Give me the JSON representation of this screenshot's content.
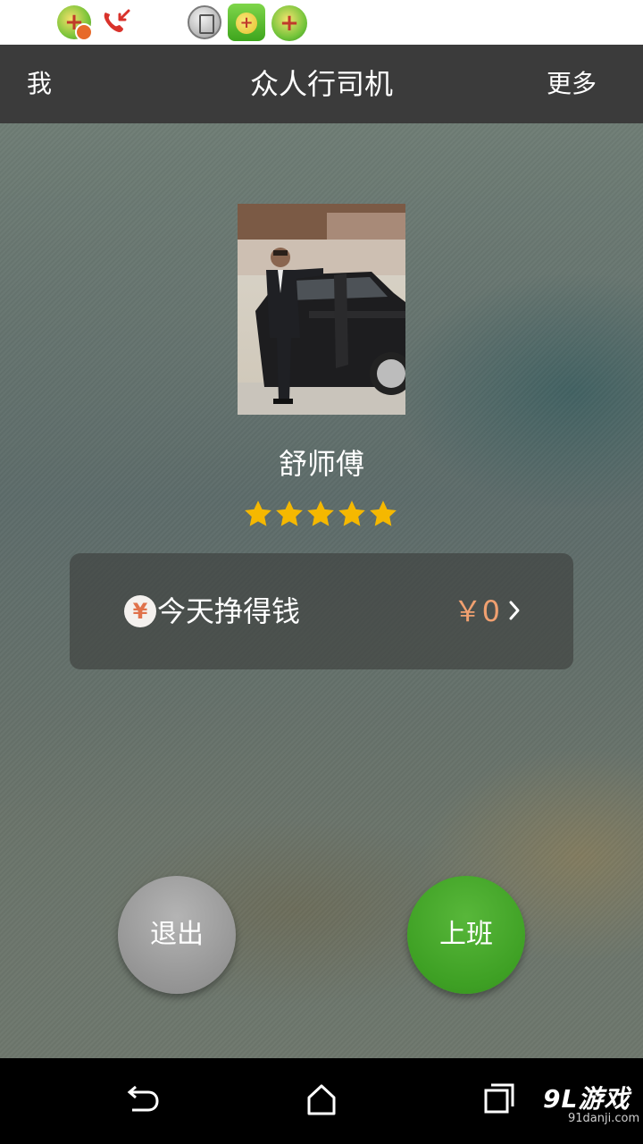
{
  "header": {
    "left_label": "我",
    "title": "众人行司机",
    "right_label": "更多"
  },
  "profile": {
    "name": "舒师傅",
    "rating_stars": 5
  },
  "earnings": {
    "label": "今天挣得钱",
    "icon": "¥",
    "value": "￥0"
  },
  "actions": {
    "exit_label": "退出",
    "work_label": "上班"
  },
  "watermark": {
    "logo": "9L游戏",
    "url": "91danji.com"
  },
  "colors": {
    "header_bg": "#3b3b3b",
    "star": "#f5b800",
    "earnings_value": "#f0a070",
    "work_button": "#3ea024",
    "exit_button": "#959595"
  }
}
